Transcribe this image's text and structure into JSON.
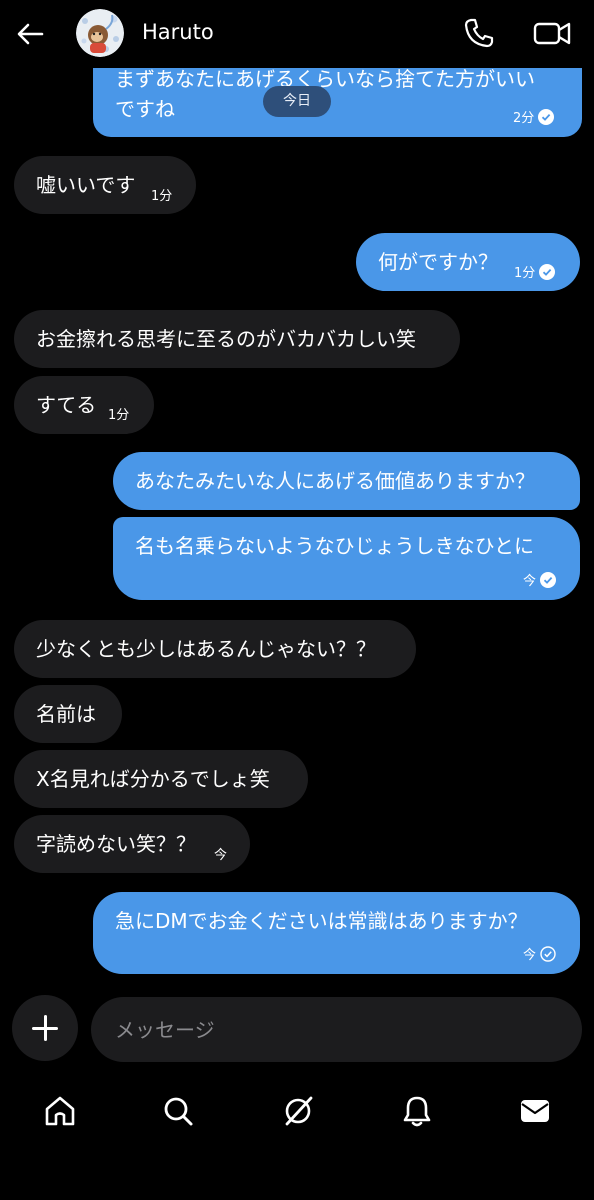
{
  "header": {
    "title": "Haruto"
  },
  "date_pill": "今日",
  "messages": [
    {
      "dir": "out",
      "lines": [
        "まずあなたにあげるくらいなら捨てた方がいい",
        "ですね"
      ],
      "time": "2分",
      "status": "read"
    },
    {
      "dir": "in",
      "text": "嘘いいです",
      "time": "1分"
    },
    {
      "dir": "out",
      "text": "何がですか？",
      "time": "1分",
      "status": "read"
    },
    {
      "dir": "in",
      "text": "お金擦れる思考に至るのがバカバカしい笑"
    },
    {
      "dir": "in",
      "text": "すてる",
      "time": "1分"
    },
    {
      "dir": "out",
      "text": "あなたみたいな人にあげる価値ありますか？"
    },
    {
      "dir": "out",
      "text": "名も名乗らないようなひじょうしきなひとに",
      "time": "今",
      "status": "read"
    },
    {
      "dir": "in",
      "text": "少なくとも少しはあるんじゃない？？"
    },
    {
      "dir": "in",
      "text": "名前は"
    },
    {
      "dir": "in",
      "text": "X名見れば分かるでしょ笑"
    },
    {
      "dir": "in",
      "text": "字読めない笑？？",
      "time": "今"
    },
    {
      "dir": "out",
      "text": "急にDMでお金くださいは常識はありますか？",
      "time": "今",
      "status": "sent"
    }
  ],
  "composer": {
    "placeholder": "メッセージ"
  },
  "colors": {
    "outgoing_bubble": "#4a97e8",
    "incoming_bubble": "#1c1c1e",
    "background": "#000000",
    "date_pill": "#2e4f7a"
  },
  "icons": {
    "back": "arrow-left-icon",
    "call": "phone-icon",
    "video": "video-camera-icon",
    "add": "plus-icon",
    "tabs": [
      "home-icon",
      "search-icon",
      "communities-icon",
      "bell-icon",
      "mail-icon"
    ]
  }
}
